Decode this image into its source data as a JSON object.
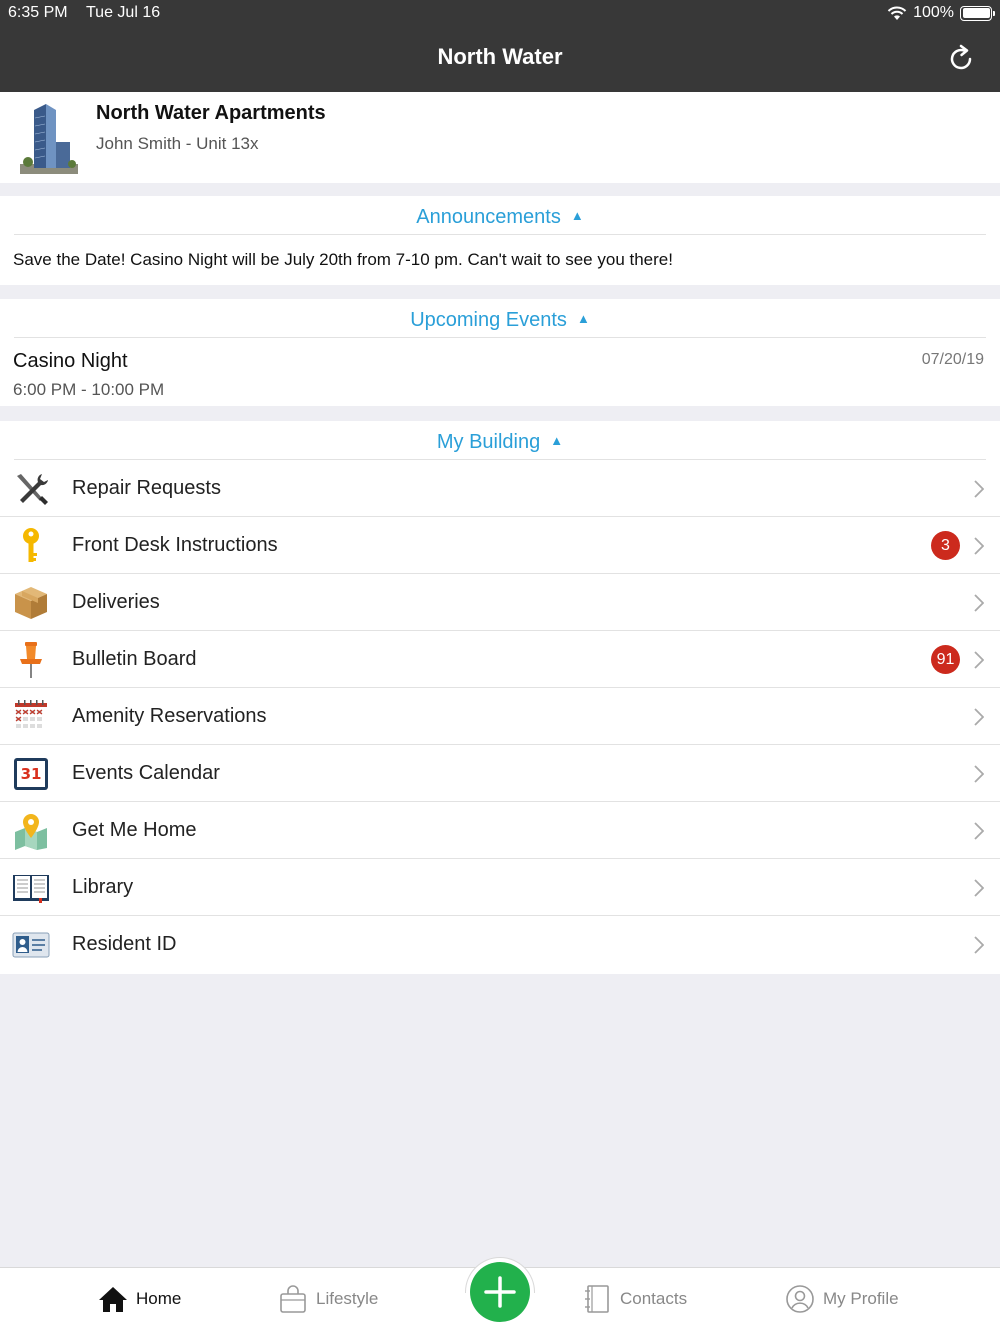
{
  "status_bar": {
    "time": "6:35 PM",
    "date": "Tue Jul 16",
    "battery": "100%"
  },
  "nav": {
    "title": "North Water",
    "refresh_icon": "refresh-icon"
  },
  "building": {
    "name": "North Water Apartments",
    "resident": "John Smith - Unit 13x"
  },
  "announcements": {
    "title": "Announcements",
    "arrow": "▲",
    "text": "Save the Date! Casino Night will be July 20th from 7-10 pm. Can't wait to see you there!"
  },
  "events": {
    "title": "Upcoming Events",
    "arrow": "▲",
    "items": [
      {
        "title": "Casino Night",
        "time": "6:00 PM - 10:00 PM",
        "date": "07/20/19"
      }
    ]
  },
  "my_building": {
    "title": "My Building",
    "arrow": "▲",
    "items": [
      {
        "label": "Repair Requests",
        "icon": "tools-icon",
        "badge": ""
      },
      {
        "label": "Front Desk Instructions",
        "icon": "key-icon",
        "badge": "3"
      },
      {
        "label": "Deliveries",
        "icon": "package-icon",
        "badge": ""
      },
      {
        "label": "Bulletin Board",
        "icon": "pushpin-icon",
        "badge": "91"
      },
      {
        "label": "Amenity Reservations",
        "icon": "reservation-calendar-icon",
        "badge": ""
      },
      {
        "label": "Events Calendar",
        "icon": "calendar-31-icon",
        "badge": ""
      },
      {
        "label": "Get Me Home",
        "icon": "map-pin-icon",
        "badge": ""
      },
      {
        "label": "Library",
        "icon": "book-icon",
        "badge": ""
      },
      {
        "label": "Resident ID",
        "icon": "id-card-icon",
        "badge": ""
      }
    ]
  },
  "tabbar": {
    "home": "Home",
    "lifestyle": "Lifestyle",
    "contacts": "Contacts",
    "profile": "My Profile"
  },
  "colors": {
    "nav_bg": "#383838",
    "accent": "#2a9fd8",
    "badge": "#cc2a1d",
    "fab": "#22b14c"
  }
}
